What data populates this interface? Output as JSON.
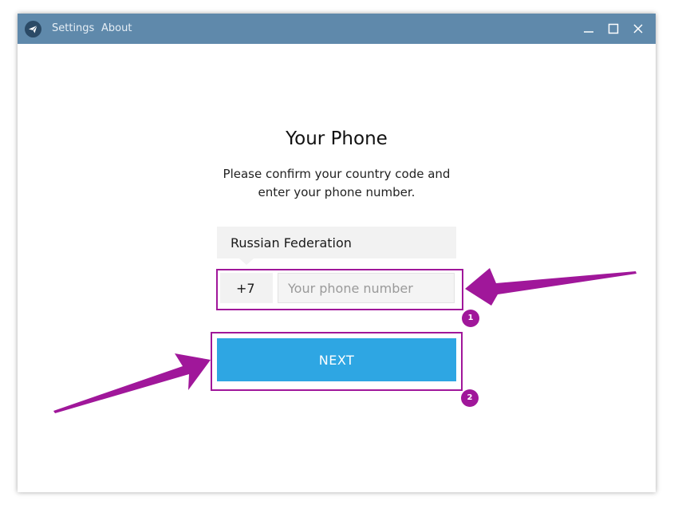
{
  "titlebar": {
    "menu": [
      "Settings",
      "About"
    ],
    "background": "#5f89ab"
  },
  "main": {
    "title": "Your Phone",
    "subtitle_line1": "Please confirm your country code and",
    "subtitle_line2": "enter your phone number.",
    "country": "Russian Federation",
    "country_code": "+7",
    "phone_value": "",
    "phone_placeholder": "Your phone number",
    "next_label": "NEXT",
    "accent": "#2ea6e3"
  },
  "annotations": {
    "color": "#a0179a",
    "badges": [
      "1",
      "2"
    ]
  }
}
